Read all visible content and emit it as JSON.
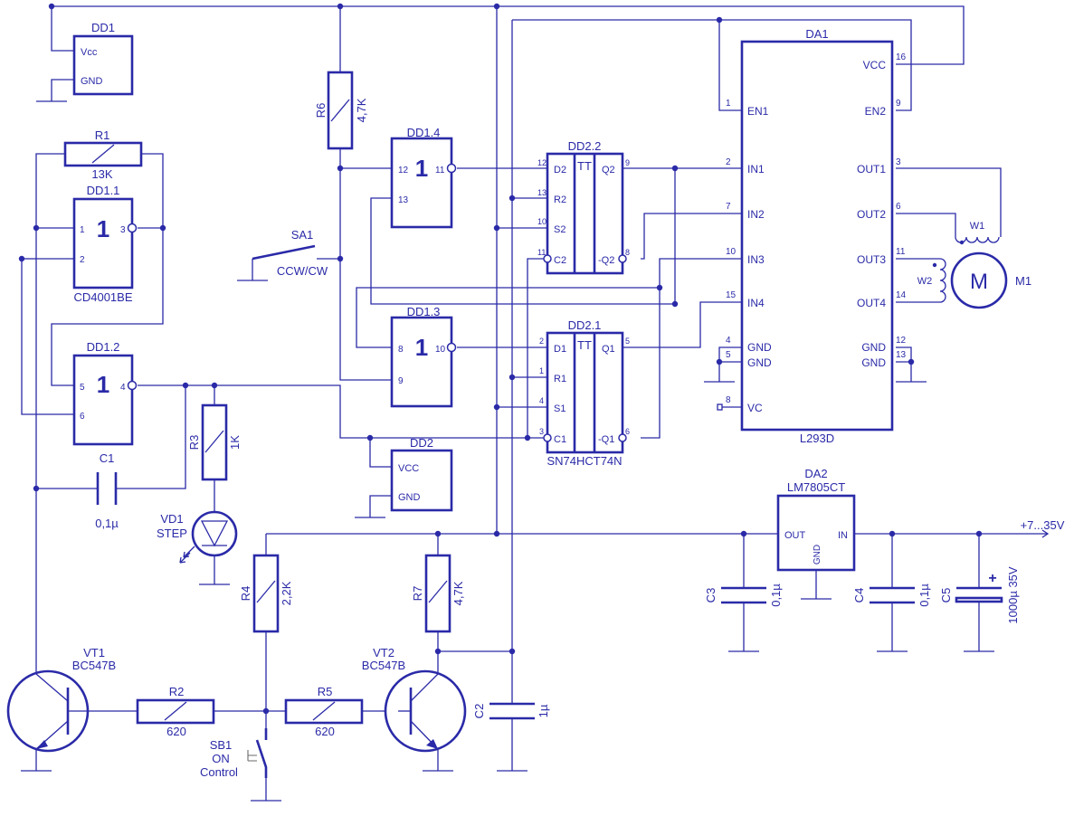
{
  "components": {
    "dd1": {
      "name": "DD1",
      "pin_vcc": "Vcc",
      "pin_gnd": "GND"
    },
    "r1": {
      "name": "R1",
      "value": "13K"
    },
    "dd1_1": {
      "name": "DD1.1",
      "symbol": "1",
      "pin_a": "1",
      "pin_b": "2",
      "pin_out": "3",
      "part": "CD4001BE"
    },
    "dd1_2": {
      "name": "DD1.2",
      "symbol": "1",
      "pin_a": "5",
      "pin_b": "6",
      "pin_out": "4"
    },
    "c1": {
      "name": "C1",
      "value": "0,1µ"
    },
    "r3": {
      "name": "R3",
      "value": "1K"
    },
    "vd1": {
      "name": "VD1",
      "label": "STEP"
    },
    "r6": {
      "name": "R6",
      "value": "4,7K"
    },
    "dd1_4": {
      "name": "DD1.4",
      "symbol": "1",
      "pin_a": "12",
      "pin_b": "13",
      "pin_out": "11"
    },
    "dd1_3": {
      "name": "DD1.3",
      "symbol": "1",
      "pin_a": "8",
      "pin_b": "9",
      "pin_out": "10"
    },
    "sa1": {
      "name": "SA1",
      "label": "CCW/CW"
    },
    "dd2": {
      "name": "DD2",
      "pin_vcc": "VCC",
      "pin_gnd": "GND"
    },
    "dd2_2": {
      "name": "DD2.2",
      "tt": "TT",
      "pins_left": [
        "12",
        "13",
        "10",
        "11"
      ],
      "labels_left": [
        "D2",
        "R2",
        "S2",
        "C2"
      ],
      "pins_right": [
        "9",
        "8"
      ],
      "labels_right": [
        "Q2",
        "-Q2"
      ]
    },
    "dd2_1": {
      "name": "DD2.1",
      "tt": "TT",
      "pins_left": [
        "2",
        "1",
        "4",
        "3"
      ],
      "labels_left": [
        "D1",
        "R1",
        "S1",
        "C1"
      ],
      "pins_right": [
        "5",
        "6"
      ],
      "labels_right": [
        "Q1",
        "-Q1"
      ],
      "part": "SN74HCT74N"
    },
    "da1": {
      "name": "DA1",
      "part": "L293D",
      "left_pins": [
        "1",
        "2",
        "7",
        "10",
        "15",
        "4",
        "5",
        "8"
      ],
      "left_labels": [
        "EN1",
        "IN1",
        "IN2",
        "IN3",
        "IN4",
        "GND",
        "GND",
        "VC"
      ],
      "right_pins": [
        "16",
        "9",
        "3",
        "6",
        "11",
        "14",
        "12",
        "13"
      ],
      "right_labels": [
        "VCC",
        "EN2",
        "OUT1",
        "OUT2",
        "OUT3",
        "OUT4",
        "GND",
        "GND"
      ]
    },
    "m1": {
      "name": "M1",
      "symbol": "M",
      "w1": "W1",
      "w2": "W2"
    },
    "da2": {
      "name": "DA2",
      "part": "LM7805CT",
      "pin_out": "OUT",
      "pin_in": "IN",
      "pin_gnd": "GND"
    },
    "power": {
      "label": "+7...35V"
    },
    "c3": {
      "name": "C3",
      "value": "0,1µ"
    },
    "c4": {
      "name": "C4",
      "value": "0,1µ"
    },
    "c5": {
      "name": "C5",
      "value": "1000µ 35V",
      "polarity": "+"
    },
    "r4": {
      "name": "R4",
      "value": "2,2K"
    },
    "r7": {
      "name": "R7",
      "value": "4,7K"
    },
    "vt1": {
      "name": "VT1",
      "part": "BC547B"
    },
    "vt2": {
      "name": "VT2",
      "part": "BC547B"
    },
    "r2": {
      "name": "R2",
      "value": "620"
    },
    "r5": {
      "name": "R5",
      "value": "620"
    },
    "sb1": {
      "name": "SB1",
      "line1": "ON",
      "line2": "Control"
    },
    "c2": {
      "name": "C2",
      "value": "1µ"
    }
  }
}
